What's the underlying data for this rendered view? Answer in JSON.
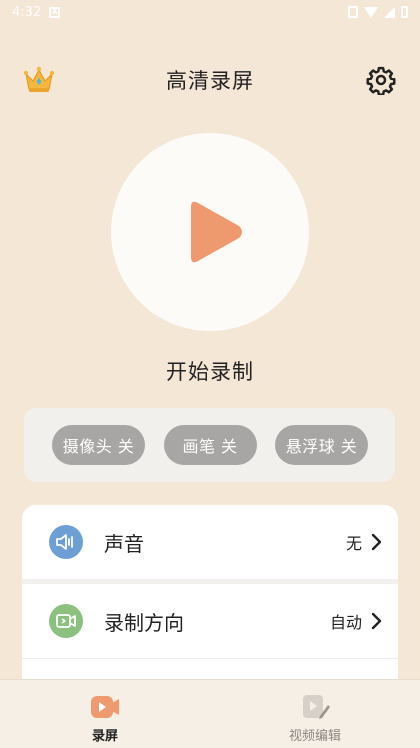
{
  "status_bar": {
    "time": "4:32",
    "icons": [
      "notification-icon",
      "vibrate-icon",
      "wifi-icon",
      "signal-icon",
      "battery-icon"
    ]
  },
  "header": {
    "title": "高清录屏",
    "left_icon": "crown-icon",
    "right_icon": "gear-icon"
  },
  "record": {
    "label": "开始录制",
    "icon": "play-icon"
  },
  "toggles": [
    {
      "label": "摄像头 关"
    },
    {
      "label": "画笔 关"
    },
    {
      "label": "悬浮球 关"
    }
  ],
  "settings": {
    "rows": [
      {
        "label": "声音",
        "value": "无",
        "icon": "speaker-icon"
      },
      {
        "label": "录制方向",
        "value": "自动",
        "icon": "video-camera-icon"
      }
    ]
  },
  "bottom_nav": {
    "items": [
      {
        "label": "录屏",
        "icon": "record-icon",
        "active": true
      },
      {
        "label": "视频编辑",
        "icon": "video-edit-icon",
        "active": false
      }
    ]
  },
  "colors": {
    "background": "#f5e7d6",
    "accent": "#ee9a6e",
    "toggle_off": "#a8a6a4",
    "sound_icon_bg": "#6e9fd4",
    "direction_icon_bg": "#8cc07e"
  }
}
